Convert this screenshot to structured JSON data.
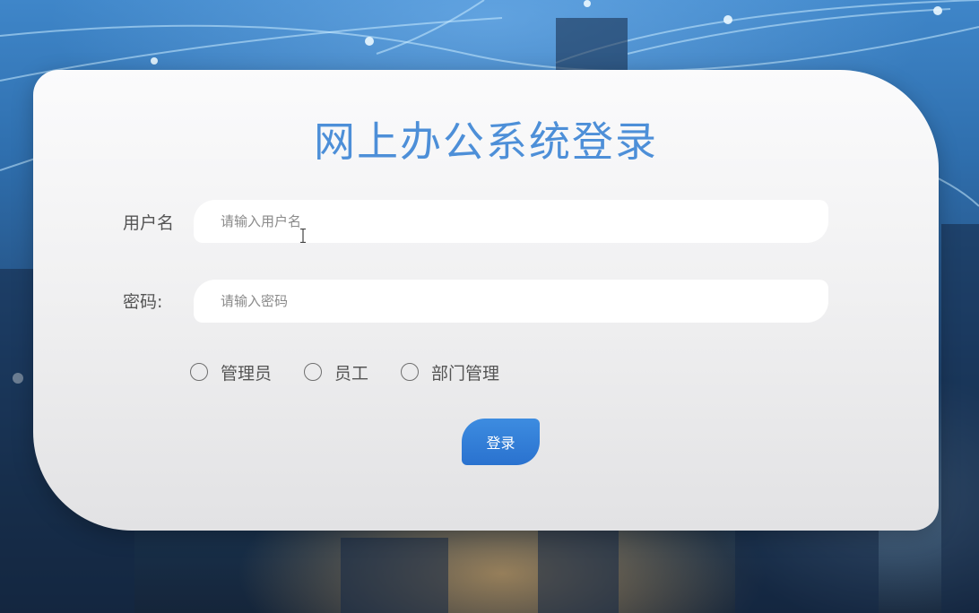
{
  "login": {
    "title": "网上办公系统登录",
    "username_label": "用户名",
    "username_placeholder": "请输入用户名",
    "username_value": "",
    "password_label": "密码:",
    "password_placeholder": "请输入密码",
    "password_value": "",
    "roles": [
      "管理员",
      "员工",
      "部门管理"
    ],
    "submit_label": "登录"
  },
  "colors": {
    "title": "#4d8fd8",
    "button": "#2a72cf"
  }
}
